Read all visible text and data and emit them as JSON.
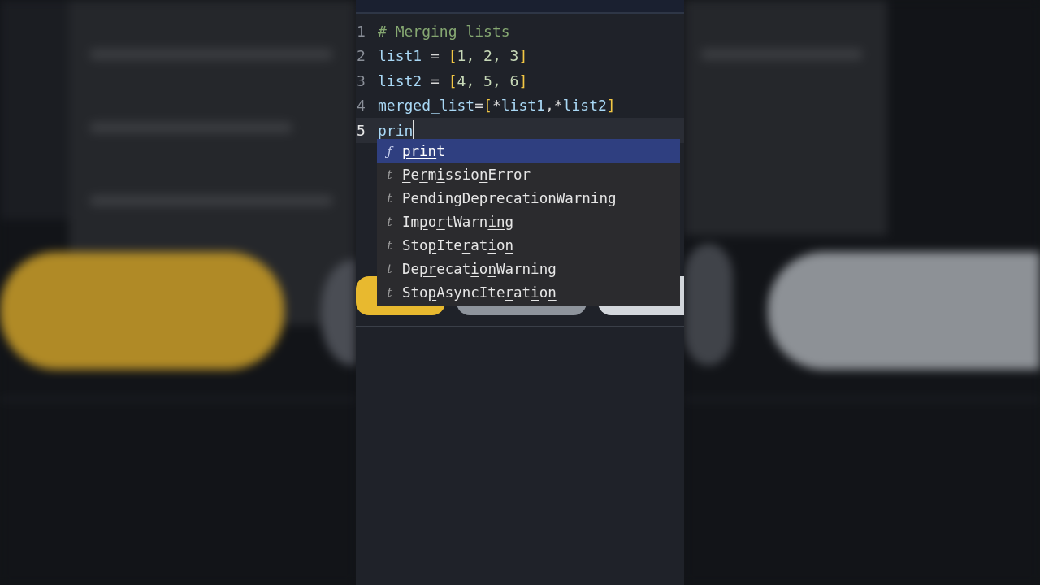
{
  "editor": {
    "lines": [
      {
        "number": "1",
        "active": false,
        "tokens": [
          {
            "kind": "comment",
            "text": "# Merging lists"
          }
        ]
      },
      {
        "number": "2",
        "active": false,
        "tokens": [
          {
            "kind": "name",
            "text": "list1"
          },
          {
            "kind": "op",
            "text": " = "
          },
          {
            "kind": "bracket",
            "text": "["
          },
          {
            "kind": "number",
            "text": "1, 2, 3"
          },
          {
            "kind": "bracket",
            "text": "]"
          }
        ]
      },
      {
        "number": "3",
        "active": false,
        "tokens": [
          {
            "kind": "name",
            "text": "list2"
          },
          {
            "kind": "op",
            "text": " = "
          },
          {
            "kind": "bracket",
            "text": "["
          },
          {
            "kind": "number",
            "text": "4, 5, 6"
          },
          {
            "kind": "bracket",
            "text": "]"
          }
        ]
      },
      {
        "number": "4",
        "active": false,
        "tokens": [
          {
            "kind": "name",
            "text": "merged_list"
          },
          {
            "kind": "op",
            "text": "="
          },
          {
            "kind": "bracket",
            "text": "["
          },
          {
            "kind": "op",
            "text": "*"
          },
          {
            "kind": "name",
            "text": "list1"
          },
          {
            "kind": "op",
            "text": ",*"
          },
          {
            "kind": "name",
            "text": "list2"
          },
          {
            "kind": "bracket",
            "text": "]"
          }
        ]
      },
      {
        "number": "5",
        "active": true,
        "cursor": true,
        "tokens": [
          {
            "kind": "name",
            "text": "prin"
          }
        ]
      }
    ]
  },
  "autocomplete": {
    "items": [
      {
        "symbol": "ƒ",
        "selected": true,
        "parts": [
          {
            "text": "prin",
            "matched": true
          },
          {
            "text": "t",
            "matched": false
          }
        ]
      },
      {
        "symbol": "t",
        "selected": false,
        "parts": [
          {
            "text": "P",
            "matched": true
          },
          {
            "text": "e",
            "matched": false
          },
          {
            "text": "r",
            "matched": true
          },
          {
            "text": "m",
            "matched": false
          },
          {
            "text": "i",
            "matched": true
          },
          {
            "text": "ssio",
            "matched": false
          },
          {
            "text": "n",
            "matched": true
          },
          {
            "text": "Error",
            "matched": false
          }
        ]
      },
      {
        "symbol": "t",
        "selected": false,
        "parts": [
          {
            "text": "P",
            "matched": true
          },
          {
            "text": "endingDep",
            "matched": false
          },
          {
            "text": "r",
            "matched": true
          },
          {
            "text": "ecat",
            "matched": false
          },
          {
            "text": "i",
            "matched": true
          },
          {
            "text": "o",
            "matched": false
          },
          {
            "text": "n",
            "matched": true
          },
          {
            "text": "Warning",
            "matched": false
          }
        ]
      },
      {
        "symbol": "t",
        "selected": false,
        "parts": [
          {
            "text": "Im",
            "matched": false
          },
          {
            "text": "p",
            "matched": true
          },
          {
            "text": "o",
            "matched": false
          },
          {
            "text": "r",
            "matched": true
          },
          {
            "text": "tWarn",
            "matched": false
          },
          {
            "text": "ing",
            "matched": true
          }
        ]
      },
      {
        "symbol": "t",
        "selected": false,
        "parts": [
          {
            "text": "Sto",
            "matched": false
          },
          {
            "text": "p",
            "matched": true
          },
          {
            "text": "Ite",
            "matched": false
          },
          {
            "text": "r",
            "matched": true
          },
          {
            "text": "at",
            "matched": false
          },
          {
            "text": "i",
            "matched": true
          },
          {
            "text": "o",
            "matched": false
          },
          {
            "text": "n",
            "matched": true
          }
        ]
      },
      {
        "symbol": "t",
        "selected": false,
        "parts": [
          {
            "text": "De",
            "matched": false
          },
          {
            "text": "pr",
            "matched": true
          },
          {
            "text": "ecat",
            "matched": false
          },
          {
            "text": "i",
            "matched": true
          },
          {
            "text": "o",
            "matched": false
          },
          {
            "text": "n",
            "matched": true
          },
          {
            "text": "Warning",
            "matched": false
          }
        ]
      },
      {
        "symbol": "t",
        "selected": false,
        "parts": [
          {
            "text": "Sto",
            "matched": false
          },
          {
            "text": "p",
            "matched": true
          },
          {
            "text": "AsyncIte",
            "matched": false
          },
          {
            "text": "r",
            "matched": true
          },
          {
            "text": "at",
            "matched": false
          },
          {
            "text": "i",
            "matched": true
          },
          {
            "text": "o",
            "matched": false
          },
          {
            "text": "n",
            "matched": true
          }
        ]
      }
    ]
  },
  "toolbar": {
    "buttons": [
      {
        "kind": "primary"
      },
      {
        "kind": "secondary"
      },
      {
        "kind": "light"
      }
    ]
  }
}
